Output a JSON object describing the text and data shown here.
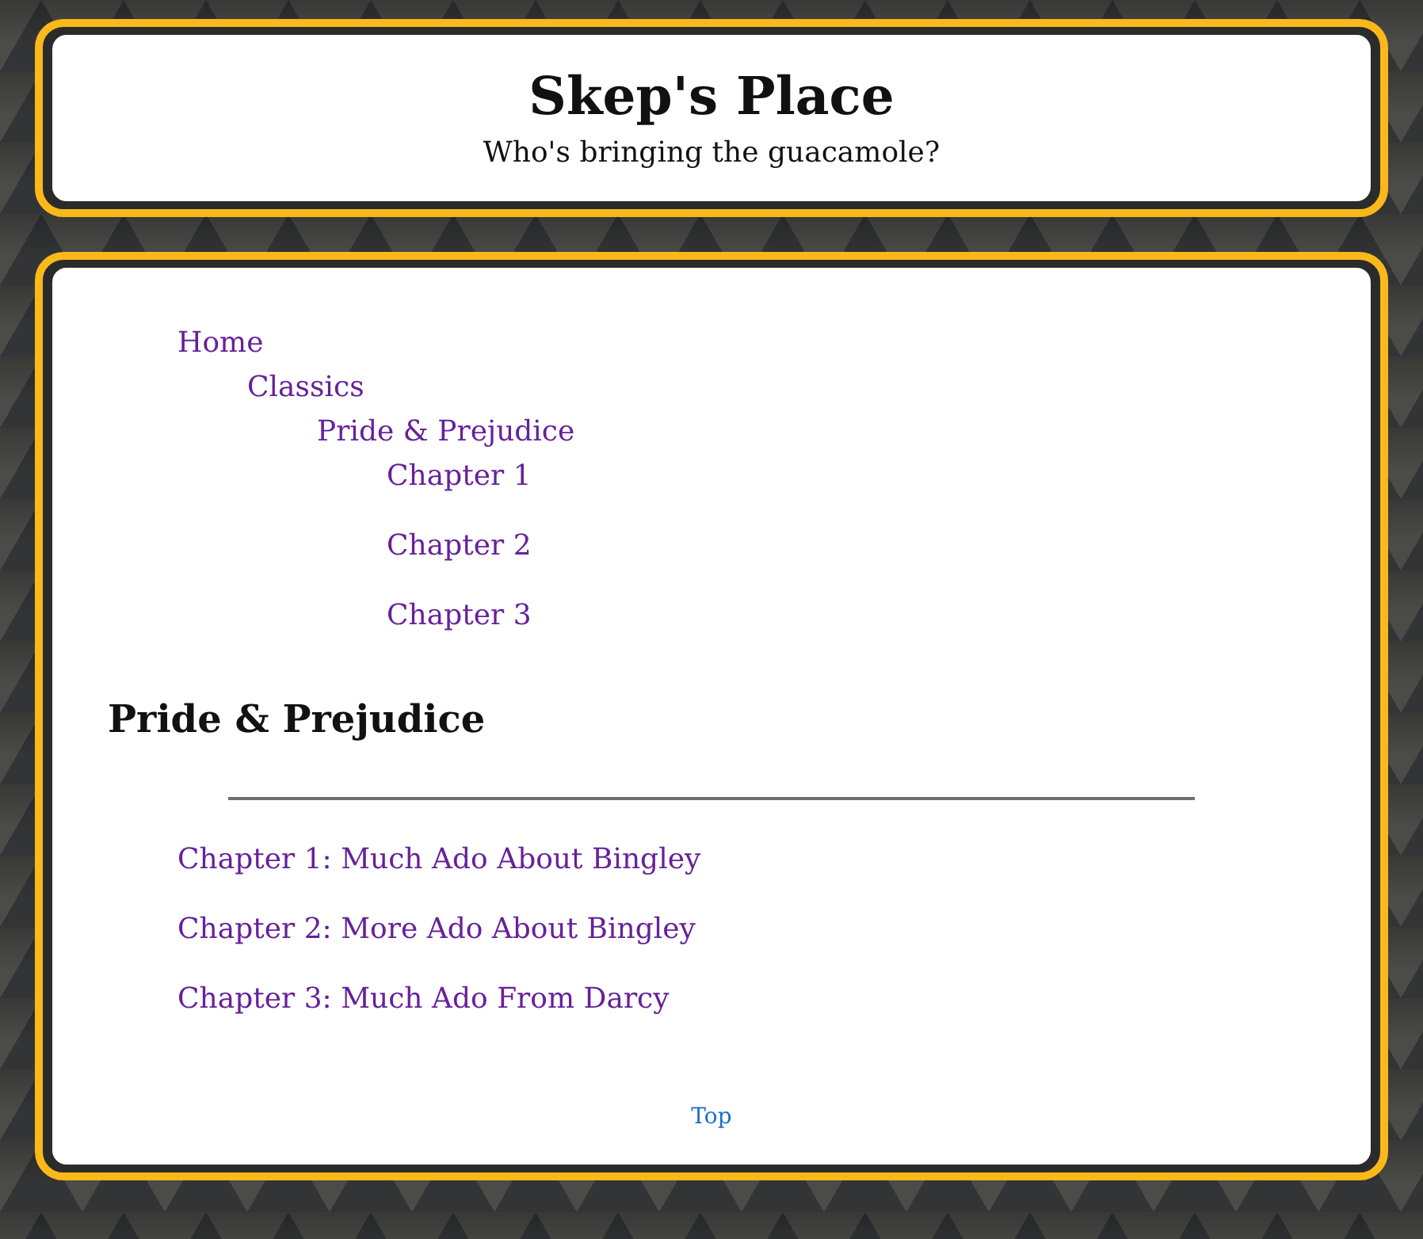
{
  "header": {
    "title": "Skep's Place",
    "subtitle": "Who's bringing the guacamole?"
  },
  "breadcrumb": [
    {
      "label": "Home",
      "children": [
        {
          "label": "Classics",
          "children": [
            {
              "label": "Pride & Prejudice",
              "children": [
                {
                  "label": "Chapter 1"
                },
                {
                  "label": "Chapter 2"
                },
                {
                  "label": "Chapter 3"
                }
              ]
            }
          ]
        }
      ]
    }
  ],
  "page": {
    "heading": "Pride & Prejudice",
    "chapters": [
      "Chapter 1: Much Ado About Bingley",
      "Chapter 2: More Ado About Bingley",
      "Chapter 3: Much Ado From Darcy"
    ]
  },
  "footer": {
    "top_link": "Top"
  }
}
